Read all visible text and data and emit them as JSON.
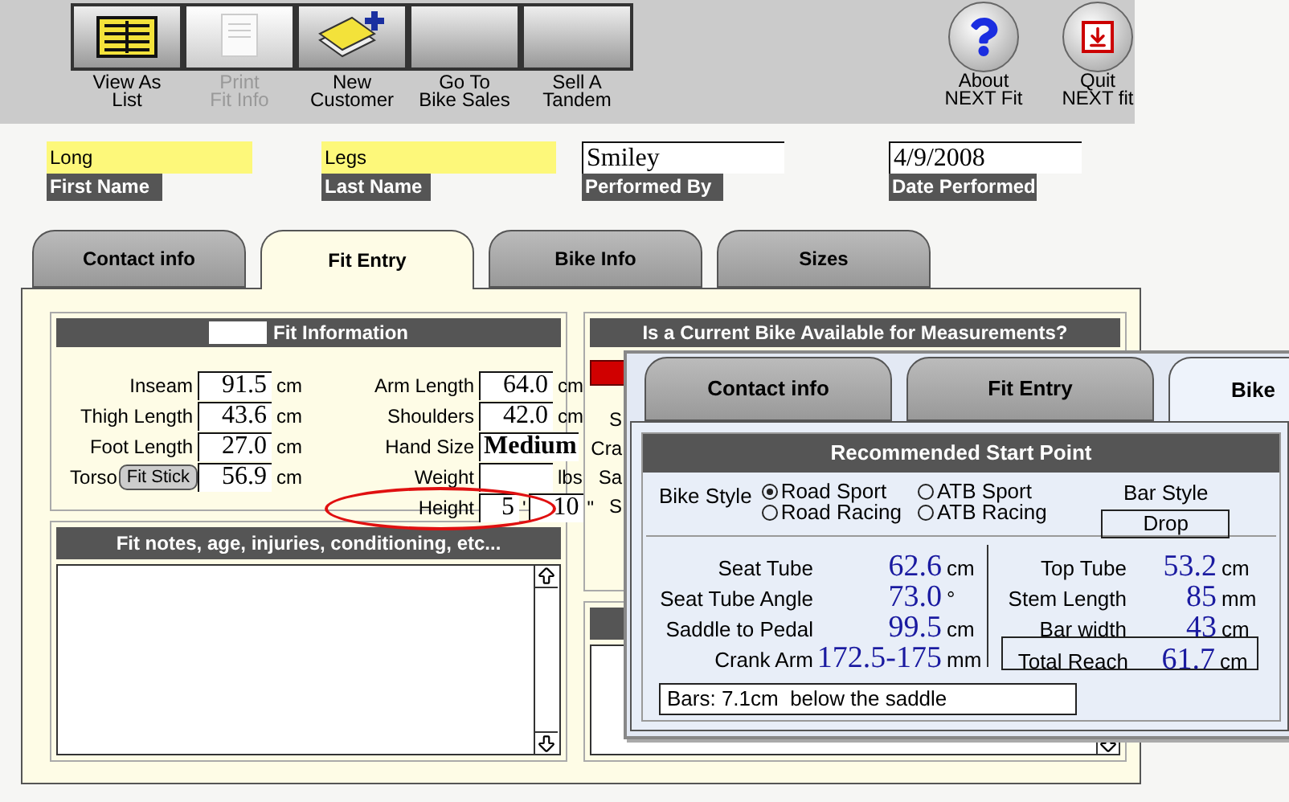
{
  "toolbar": {
    "buttons": [
      {
        "lines": [
          "View As",
          "List"
        ],
        "kind": "list",
        "disabled": false
      },
      {
        "lines": [
          "Print",
          "Fit Info"
        ],
        "kind": "document",
        "disabled": true
      },
      {
        "lines": [
          "New",
          "Customer"
        ],
        "kind": "card",
        "disabled": false
      },
      {
        "lines": [
          "Go To",
          "Bike Sales"
        ],
        "kind": "blank",
        "disabled": false
      },
      {
        "lines": [
          "Sell A",
          "Tandem"
        ],
        "kind": "blank",
        "disabled": false
      }
    ]
  },
  "app_buttons": [
    {
      "lines": [
        "About",
        "NEXT Fit"
      ],
      "kind": "help"
    },
    {
      "lines": [
        "Quit",
        "NEXT fit"
      ],
      "kind": "quit"
    }
  ],
  "header_fields": [
    {
      "label": "First Name",
      "value": "Long",
      "kind": "highlighted"
    },
    {
      "label": "Last Name",
      "value": "Legs",
      "kind": "highlighted"
    },
    {
      "label": "Performed By",
      "value": "Smiley",
      "kind": "plain"
    },
    {
      "label": "Date Performed",
      "value": "4/9/2008",
      "kind": "plain"
    }
  ],
  "tabs": [
    {
      "label": "Contact info",
      "selected": false
    },
    {
      "label": "Fit Entry",
      "selected": true
    },
    {
      "label": "Bike Info",
      "selected": false
    },
    {
      "label": "Sizes",
      "selected": false
    }
  ],
  "fit_information": {
    "title": "Fit Information",
    "left_rows": [
      {
        "kind": "measure",
        "label": "Inseam",
        "value": "91.5",
        "unit": "cm"
      },
      {
        "kind": "measure",
        "label": "Thigh Length",
        "value": "43.6",
        "unit": "cm"
      },
      {
        "kind": "measure",
        "label": "Foot Length",
        "value": "27.0",
        "unit": "cm"
      },
      {
        "kind": "button_measure",
        "label": "Torso",
        "button": "Fit Stick",
        "value": "56.9",
        "unit": "cm"
      }
    ],
    "right_rows": [
      {
        "kind": "measure",
        "label": "Arm Length",
        "value": "64.0",
        "unit": "cm"
      },
      {
        "kind": "measure",
        "label": "Shoulders",
        "value": "42.0",
        "unit": "cm"
      },
      {
        "kind": "measure",
        "label": "Hand Size",
        "value": "Medium"
      },
      {
        "kind": "measure",
        "label": "Weight",
        "unit": "lbs"
      },
      {
        "kind": "height",
        "label": "Height",
        "feet": "5",
        "feet_mark": "'",
        "inches": "10",
        "inches_mark": "\"",
        "circled": true
      }
    ]
  },
  "notes": {
    "title": "Fit notes, age, injuries, conditioning, etc..."
  },
  "bike_panel": {
    "title": "Is a Current Bike Available for Measurements?",
    "peek_labels": [
      "S",
      "Cra",
      "Sa",
      "S"
    ]
  },
  "overlay": {
    "tabs": [
      {
        "label": "Contact info",
        "selected": false
      },
      {
        "label": "Fit Entry",
        "selected": false
      },
      {
        "label": "Bike",
        "selected": true
      }
    ],
    "title": "Recommended Start Point",
    "bike_style": {
      "label": "Bike Style",
      "options": [
        {
          "label": "Road Sport",
          "selected": true
        },
        {
          "label": "ATB Sport",
          "selected": false
        },
        {
          "label": "Road Racing",
          "selected": false
        },
        {
          "label": "ATB Racing",
          "selected": false
        }
      ]
    },
    "bar_style": {
      "label": "Bar Style",
      "value": "Drop"
    },
    "left_rows": [
      {
        "label": "Seat Tube",
        "value": "62.6",
        "unit": "cm"
      },
      {
        "label": "Seat Tube Angle",
        "value": "73.0",
        "unit": "°"
      },
      {
        "label": "Saddle to Pedal",
        "value": "99.5",
        "unit": "cm"
      },
      {
        "label": "Crank Arm",
        "value": "172.5-175",
        "unit": "mm"
      }
    ],
    "right_rows": [
      {
        "label": "Top Tube",
        "value": "53.2",
        "unit": "cm",
        "boxed": false
      },
      {
        "label": "Stem Length",
        "value": "85",
        "unit": "mm",
        "boxed": false
      },
      {
        "label": "Bar width",
        "value": "43",
        "unit": "cm",
        "boxed": false
      },
      {
        "label": "Total Reach",
        "value": "61.7",
        "unit": "cm",
        "boxed": true
      }
    ],
    "note": "Bars: 7.1cm  below the saddle"
  }
}
